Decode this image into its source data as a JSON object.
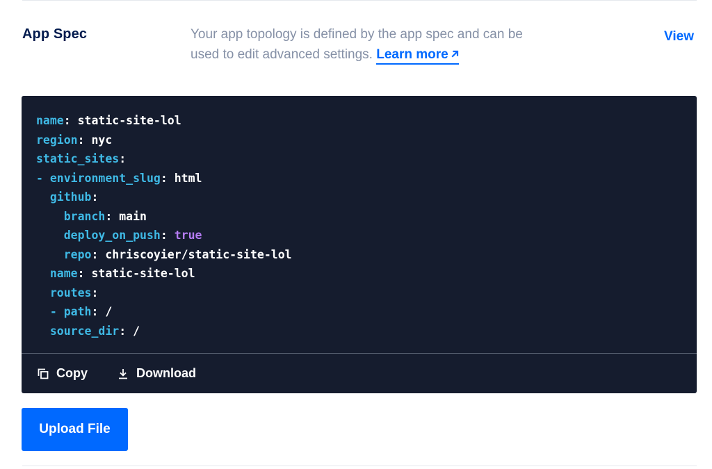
{
  "section": {
    "title": "App Spec",
    "description": "Your app topology is defined by the app spec and can be used to edit advanced settings.",
    "learn_more_label": "Learn more",
    "view_label": "View"
  },
  "code": {
    "lines": [
      {
        "indent": "",
        "key": "name",
        "value": "static-site-lol"
      },
      {
        "indent": "",
        "key": "region",
        "value": "nyc"
      },
      {
        "indent": "",
        "key": "static_sites",
        "value": ""
      },
      {
        "indent": "- ",
        "key": "environment_slug",
        "value": "html"
      },
      {
        "indent": "  ",
        "key": "github",
        "value": ""
      },
      {
        "indent": "    ",
        "key": "branch",
        "value": "main"
      },
      {
        "indent": "    ",
        "key": "deploy_on_push",
        "value": "true",
        "bool": true
      },
      {
        "indent": "    ",
        "key": "repo",
        "value": "chriscoyier/static-site-lol"
      },
      {
        "indent": "  ",
        "key": "name",
        "value": "static-site-lol"
      },
      {
        "indent": "  ",
        "key": "routes",
        "value": ""
      },
      {
        "indent": "  - ",
        "key": "path",
        "value": "/"
      },
      {
        "indent": "  ",
        "key": "source_dir",
        "value": "/"
      }
    ]
  },
  "footer": {
    "copy_label": "Copy",
    "download_label": "Download"
  },
  "upload_label": "Upload File",
  "colors": {
    "accent": "#0069ff",
    "code_bg": "#151c2e",
    "code_key": "#3fb9e5",
    "code_bool": "#b57cf5",
    "title": "#031b4e",
    "muted": "#8590a6"
  },
  "icons": {
    "learn_more": "arrow-up-right-icon",
    "copy": "copy-icon",
    "download": "download-icon"
  }
}
